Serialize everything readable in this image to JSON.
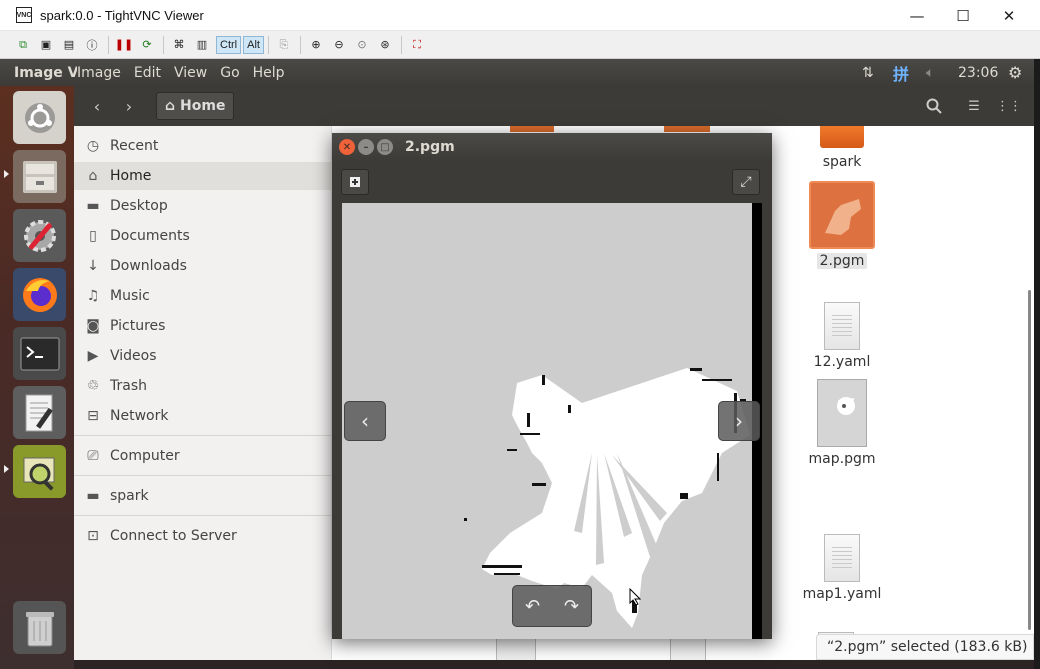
{
  "vnc": {
    "title": "spark:0.0 - TightVNC Viewer",
    "logo_text": "VNC",
    "minimize": "—",
    "maximize": "☐",
    "close": "✕",
    "toolbar": {
      "ctrl": "Ctrl",
      "alt": "Alt"
    }
  },
  "topbar": {
    "app_name": "Image Viewer",
    "menus": [
      "Image",
      "Edit",
      "View",
      "Go",
      "Help"
    ],
    "time": "23:06",
    "keyboard": "拼"
  },
  "files": {
    "header": {
      "crumb": "Home"
    },
    "sidebar": [
      {
        "label": "Recent",
        "icon": "clock-icon"
      },
      {
        "label": "Home",
        "icon": "home-icon"
      },
      {
        "label": "Desktop",
        "icon": "folder-icon"
      },
      {
        "label": "Documents",
        "icon": "document-icon"
      },
      {
        "label": "Downloads",
        "icon": "download-icon"
      },
      {
        "label": "Music",
        "icon": "music-icon"
      },
      {
        "label": "Pictures",
        "icon": "camera-icon"
      },
      {
        "label": "Videos",
        "icon": "video-icon"
      },
      {
        "label": "Trash",
        "icon": "trash-icon"
      },
      {
        "label": "Network",
        "icon": "network-icon"
      },
      {
        "label": "Computer",
        "icon": "computer-icon"
      },
      {
        "label": "spark",
        "icon": "folder-icon"
      },
      {
        "label": "Connect to Server",
        "icon": "server-icon"
      }
    ],
    "items": [
      {
        "name": "spark"
      },
      {
        "name": "2.pgm"
      },
      {
        "name": "12.yaml"
      },
      {
        "name": "map.pgm"
      },
      {
        "name": "map1.yaml"
      }
    ],
    "status": "“2.pgm” selected  (183.6 kB)"
  },
  "viewer": {
    "title": "2.pgm"
  }
}
